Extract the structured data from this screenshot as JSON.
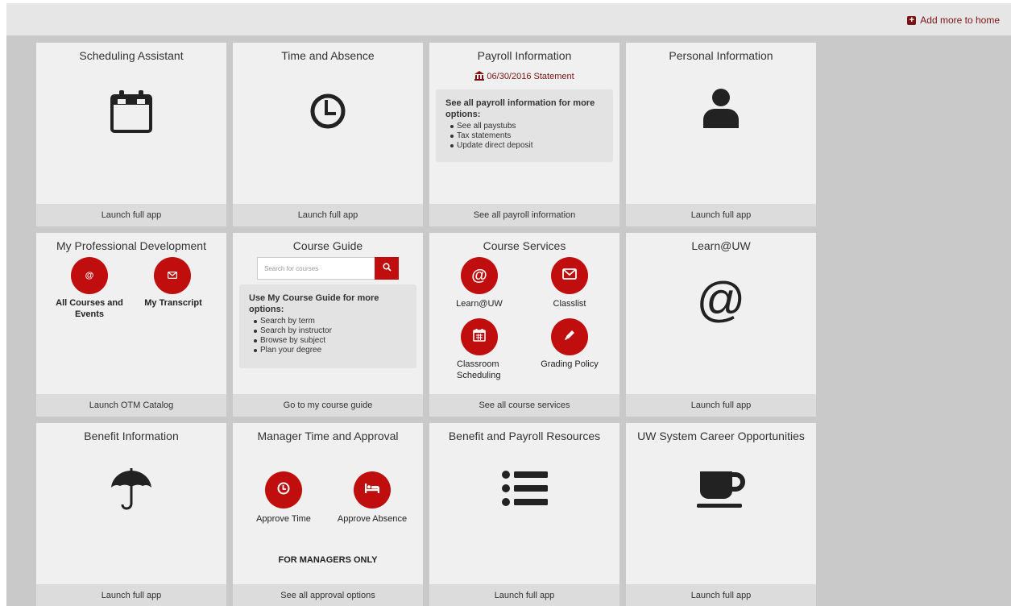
{
  "header": {
    "add_more_label": "Add more to home"
  },
  "colors": {
    "accent": "#c00d0d",
    "accent_dark": "#7a1414",
    "tile_bg": "#f0f0f0",
    "footer_bg": "#dcdcdc",
    "page_bg": "#c9c9c9"
  },
  "tiles": {
    "scheduling": {
      "title": "Scheduling Assistant",
      "footer": "Launch full app",
      "icon": "calendar-icon"
    },
    "time_absence": {
      "title": "Time and Absence",
      "footer": "Launch full app",
      "icon": "clock-icon"
    },
    "payroll": {
      "title": "Payroll Information",
      "statement": "06/30/2016 Statement",
      "info_heading": "See all payroll information for more options:",
      "info_items": [
        "See all paystubs",
        "Tax statements",
        "Update direct deposit"
      ],
      "footer": "See all payroll information"
    },
    "personal": {
      "title": "Personal Information",
      "footer": "Launch full app",
      "icon": "user-icon"
    },
    "prof_dev": {
      "title": "My Professional Development",
      "btn1_label": "All Courses and Events",
      "btn2_label": "My Transcript",
      "footer": "Launch OTM Catalog"
    },
    "course_guide": {
      "title": "Course Guide",
      "search_placeholder": "Search for courses",
      "info_heading": "Use My Course Guide for more options:",
      "info_items": [
        "Search by term",
        "Search by instructor",
        "Browse by subject",
        "Plan your degree"
      ],
      "footer": "Go to my course guide"
    },
    "course_services": {
      "title": "Course Services",
      "btn1_label": "Learn@UW",
      "btn2_label": "Classlist",
      "btn3_label": "Classroom Scheduling",
      "btn4_label": "Grading Policy",
      "footer": "See all course services"
    },
    "learn_uw": {
      "title": "Learn@UW",
      "footer": "Launch full app",
      "icon": "at-sign-icon"
    },
    "benefit_info": {
      "title": "Benefit Information",
      "footer": "Launch full app",
      "icon": "umbrella-icon"
    },
    "manager": {
      "title": "Manager Time and Approval",
      "btn1_label": "Approve Time",
      "btn2_label": "Approve Absence",
      "note": "FOR MANAGERS ONLY",
      "footer": "See all approval options"
    },
    "benefit_payroll": {
      "title": "Benefit and Payroll Resources",
      "footer": "Launch full app",
      "icon": "list-icon"
    },
    "career": {
      "title": "UW System Career Opportunities",
      "footer": "Launch full app",
      "icon": "coffee-cup-icon"
    }
  }
}
